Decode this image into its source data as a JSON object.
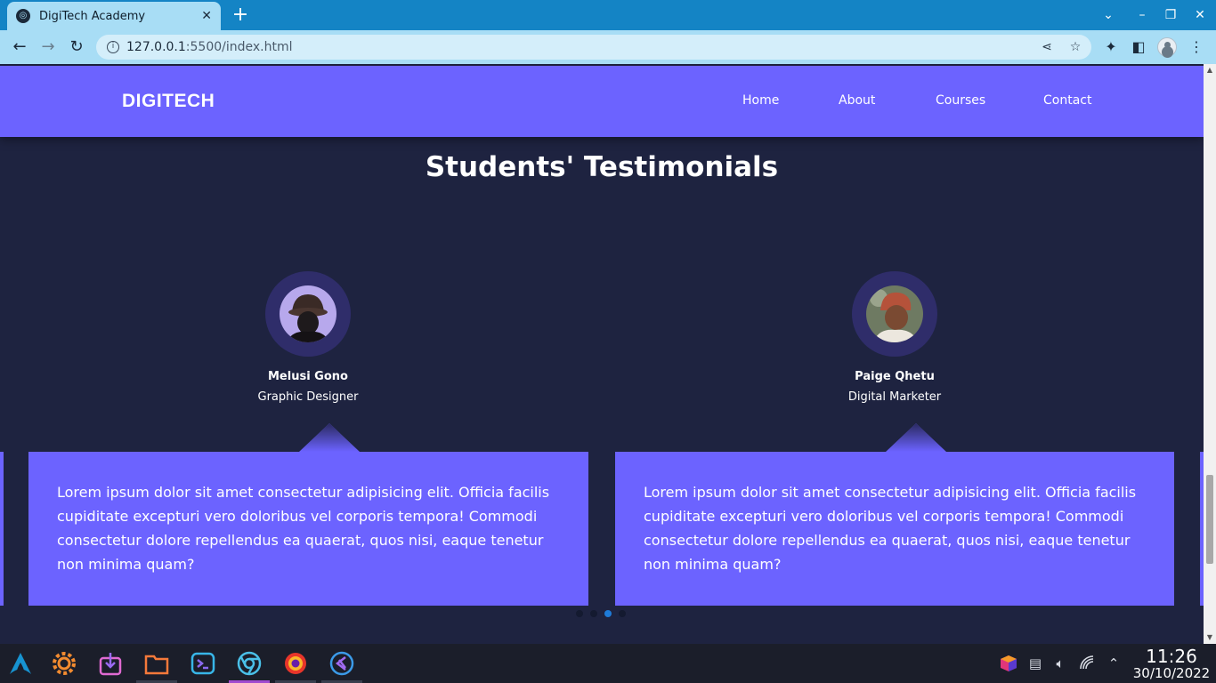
{
  "browser": {
    "tab_title": "DigiTech Academy",
    "url_host": "127.0.0.1",
    "url_path": ":5500/index.html"
  },
  "site": {
    "brand": "DIGITECH",
    "nav": [
      {
        "label": "Home"
      },
      {
        "label": "About"
      },
      {
        "label": "Courses"
      },
      {
        "label": "Contact"
      }
    ],
    "accent_color": "#6c63ff",
    "background_color": "#1e2340"
  },
  "testimonials": {
    "title": "Students' Testimonials",
    "items": [
      {
        "name": "Melusi Gono",
        "role": "Graphic Designer",
        "quote": "Lorem ipsum dolor sit amet consectetur adipisicing elit. Officia facilis cupiditate excepturi vero doloribus vel corporis tempora! Commodi consectetur dolore repellendus ea quaerat, quos nisi, eaque tenetur non minima quam?"
      },
      {
        "name": "Paige Qhetu",
        "role": "Digital Marketer",
        "quote": "Lorem ipsum dolor sit amet consectetur adipisicing elit. Officia facilis cupiditate excepturi vero doloribus vel corporis tempora! Commodi consectetur dolore repellendus ea quaerat, quos nisi, eaque tenetur non minima quam?"
      }
    ],
    "pagination": {
      "count": 4,
      "active": 3
    }
  },
  "taskbar": {
    "apps": [
      {
        "icon": "arch-launcher-icon"
      },
      {
        "icon": "settings-gear-icon"
      },
      {
        "icon": "software-store-icon"
      },
      {
        "icon": "folder-icon"
      },
      {
        "icon": "terminal-icon"
      },
      {
        "icon": "chromium-icon"
      },
      {
        "icon": "firefox-icon"
      },
      {
        "icon": "vscode-icon"
      }
    ],
    "time": "11:26",
    "date": "30/10/2022"
  }
}
